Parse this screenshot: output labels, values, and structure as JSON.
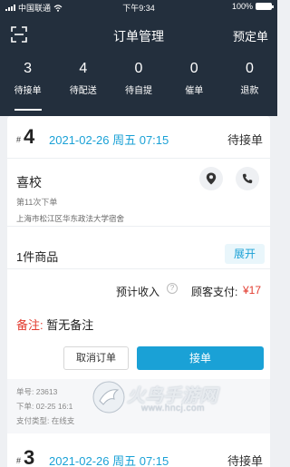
{
  "status_bar": {
    "carrier": "中国联通",
    "time": "下午9:34",
    "battery": "100%",
    "battery_level": 1.0
  },
  "nav": {
    "title": "订单管理",
    "right_action": "预定单",
    "scan_icon": "scan-icon"
  },
  "tabs": [
    {
      "count": "3",
      "label": "待接单"
    },
    {
      "count": "4",
      "label": "待配送"
    },
    {
      "count": "0",
      "label": "待自提"
    },
    {
      "count": "0",
      "label": "催单"
    },
    {
      "count": "0",
      "label": "退款"
    }
  ],
  "orders": [
    {
      "hash": "#",
      "number": "4",
      "datetime": "2021-02-26 周五 07:15",
      "status": "待接单",
      "customer": {
        "name": "喜校",
        "order_count": "第11次下单",
        "address": "上海市松江区华东政法大学宿舍"
      },
      "items_count": "1件商品",
      "expand_label": "展开",
      "estimated_income_label": "预计收入",
      "customer_paid_label": "顾客支付:",
      "customer_paid_amount": "¥17",
      "remark_label": "备注:",
      "remark_text": "暂无备注",
      "cancel_label": "取消订单",
      "accept_label": "接单",
      "info": {
        "order_no": "单号: 23613",
        "order_time": "下单: 02-25 16:1",
        "payment_type": "支付类型: 在线支"
      }
    },
    {
      "hash": "#",
      "number": "3",
      "datetime": "2021-02-26 周五 07:15",
      "status": "待接单"
    }
  ],
  "watermark": {
    "brand": "火鸟手游网",
    "url": "www.hncj.com"
  },
  "colors": {
    "header_bg": "#232f3d",
    "accent": "#1aa1d6",
    "price_red": "#e23b2f"
  }
}
